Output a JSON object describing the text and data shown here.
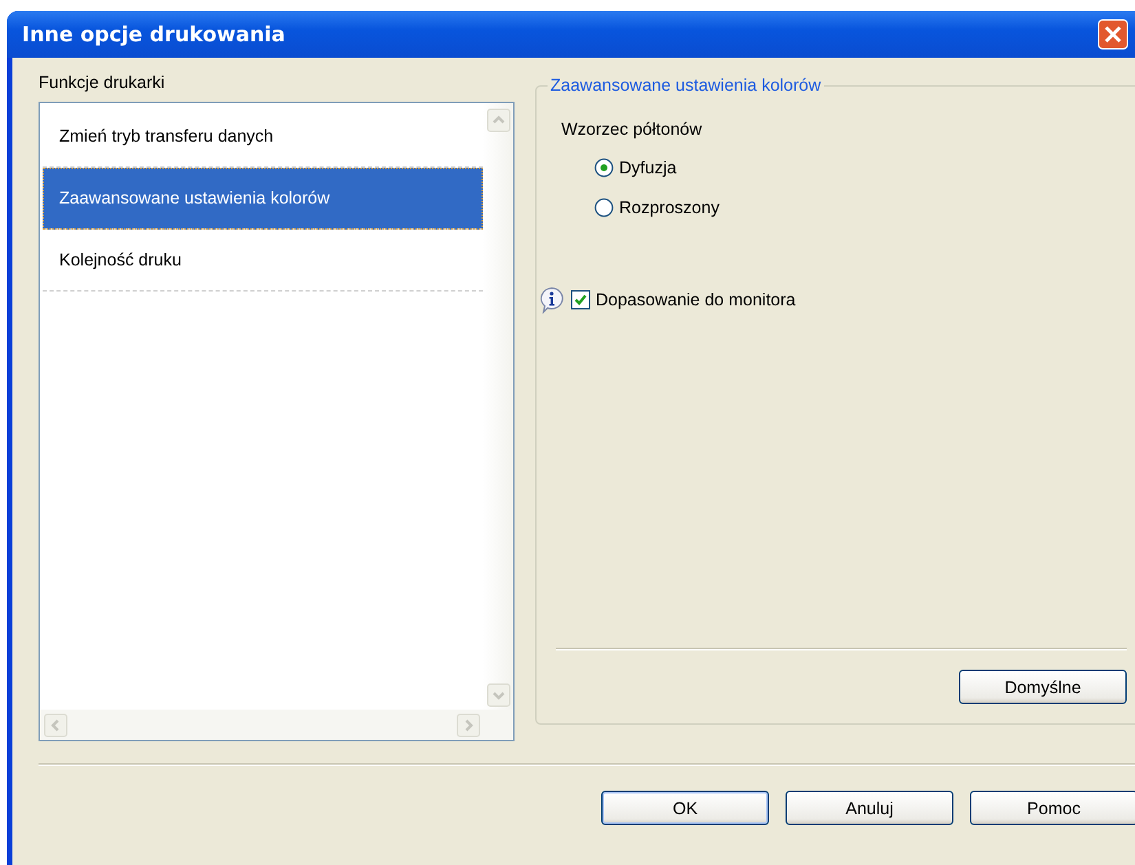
{
  "window": {
    "title": "Inne opcje drukowania"
  },
  "functions": {
    "label": "Funkcje drukarki",
    "items": [
      {
        "label": "Zmień tryb transferu danych",
        "selected": false
      },
      {
        "label": "Zaawansowane ustawienia kolorów",
        "selected": true
      },
      {
        "label": "Kolejność druku",
        "selected": false
      }
    ]
  },
  "group": {
    "title": "Zaawansowane ustawienia kolorów",
    "halftone_label": "Wzorzec półtonów",
    "radios": [
      {
        "label": "Dyfuzja",
        "selected": true
      },
      {
        "label": "Rozproszony",
        "selected": false
      }
    ],
    "checkbox": {
      "label": "Dopasowanie do monitora",
      "checked": true
    },
    "default_button": "Domyślne"
  },
  "buttons": [
    "OK",
    "Anuluj",
    "Pomoc"
  ]
}
